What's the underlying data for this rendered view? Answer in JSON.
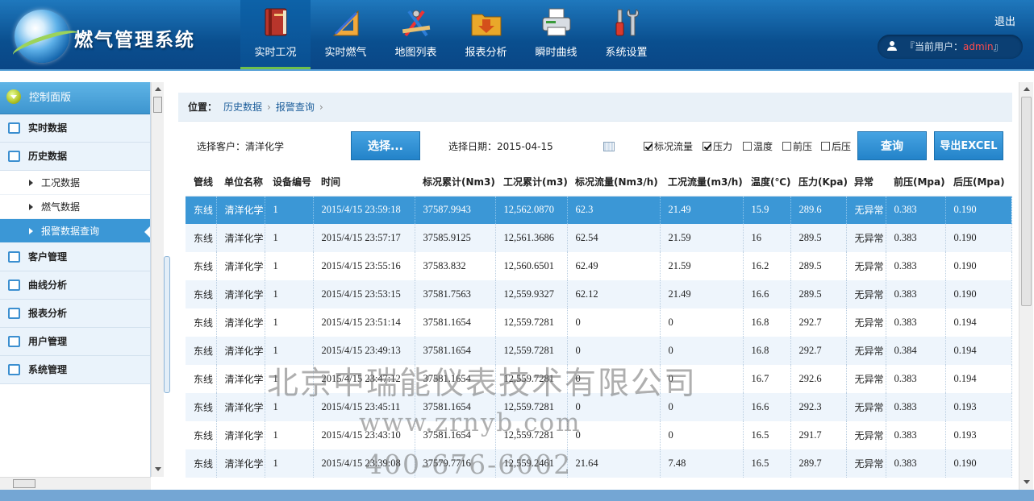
{
  "header": {
    "app_title": "燃气管理系统",
    "logout": "退出",
    "user_label": "『当前用户：",
    "user_name": "admin",
    "user_suffix": "』",
    "nav": [
      {
        "label": "实时工况",
        "icon": "book-icon",
        "active": true
      },
      {
        "label": "实时燃气",
        "icon": "ruler-icon"
      },
      {
        "label": "地图列表",
        "icon": "drafting-tools-icon"
      },
      {
        "label": "报表分析",
        "icon": "folder-download-icon"
      },
      {
        "label": "瞬时曲线",
        "icon": "printer-icon"
      },
      {
        "label": "系统设置",
        "icon": "tools-icon"
      }
    ]
  },
  "sidebar": {
    "head": "控制面版",
    "items": [
      {
        "label": "实时数据",
        "icon": "list-icon"
      },
      {
        "label": "历史数据",
        "icon": "chat-icon"
      }
    ],
    "subitems": [
      {
        "label": "工况数据"
      },
      {
        "label": "燃气数据"
      },
      {
        "label": "报警数据查询",
        "active": true
      }
    ],
    "items_after": [
      {
        "label": "客户管理",
        "icon": "edit-icon"
      },
      {
        "label": "曲线分析",
        "icon": "calendar-icon"
      },
      {
        "label": "报表分析",
        "icon": "calendar-icon"
      },
      {
        "label": "用户管理",
        "icon": "calendar-icon"
      },
      {
        "label": "系统管理",
        "icon": "calendar-icon"
      }
    ]
  },
  "breadcrumb": {
    "label": "位置：",
    "part1": "历史数据",
    "sep1": "›",
    "part2": "报警查询",
    "sep2": "›"
  },
  "filter": {
    "customer_label": "选择客户：清洋化学",
    "select_button": "选择...",
    "date_label": "选择日期：2015-04-15",
    "checks": [
      {
        "label": "标况流量",
        "checked": true
      },
      {
        "label": "压力",
        "checked": true
      },
      {
        "label": "温度",
        "checked": false
      },
      {
        "label": "前压",
        "checked": false
      },
      {
        "label": "后压",
        "checked": false
      }
    ],
    "query_button": "查询",
    "export_button": "导出EXCEL"
  },
  "table": {
    "columns": [
      "管线",
      "单位名称",
      "设备编号",
      "时间",
      "标况累计(Nm3)",
      "工况累计(m3)",
      "标况流量(Nm3/h)",
      "工况流量(m3/h)",
      "温度(℃)",
      "压力(Kpa)",
      "异常",
      "前压(Mpa)",
      "后压(Mpa)"
    ],
    "rows": [
      [
        "东线",
        "清洋化学",
        "1",
        "2015/4/15 23:59:18",
        "37587.9943",
        "12,562.0870",
        "62.3",
        "21.49",
        "15.9",
        "289.6",
        "无异常",
        "0.383",
        "0.190"
      ],
      [
        "东线",
        "清洋化学",
        "1",
        "2015/4/15 23:57:17",
        "37585.9125",
        "12,561.3686",
        "62.54",
        "21.59",
        "16",
        "289.5",
        "无异常",
        "0.383",
        "0.190"
      ],
      [
        "东线",
        "清洋化学",
        "1",
        "2015/4/15 23:55:16",
        "37583.832",
        "12,560.6501",
        "62.49",
        "21.59",
        "16.2",
        "289.5",
        "无异常",
        "0.383",
        "0.190"
      ],
      [
        "东线",
        "清洋化学",
        "1",
        "2015/4/15 23:53:15",
        "37581.7563",
        "12,559.9327",
        "62.12",
        "21.49",
        "16.6",
        "289.5",
        "无异常",
        "0.383",
        "0.190"
      ],
      [
        "东线",
        "清洋化学",
        "1",
        "2015/4/15 23:51:14",
        "37581.1654",
        "12,559.7281",
        "0",
        "0",
        "16.8",
        "292.7",
        "无异常",
        "0.383",
        "0.194"
      ],
      [
        "东线",
        "清洋化学",
        "1",
        "2015/4/15 23:49:13",
        "37581.1654",
        "12,559.7281",
        "0",
        "0",
        "16.8",
        "292.7",
        "无异常",
        "0.384",
        "0.194"
      ],
      [
        "东线",
        "清洋化学",
        "1",
        "2015/4/15 23:47:12",
        "37581.1654",
        "12,559.7281",
        "0",
        "0",
        "16.7",
        "292.6",
        "无异常",
        "0.383",
        "0.194"
      ],
      [
        "东线",
        "清洋化学",
        "1",
        "2015/4/15 23:45:11",
        "37581.1654",
        "12,559.7281",
        "0",
        "0",
        "16.6",
        "292.3",
        "无异常",
        "0.383",
        "0.193"
      ],
      [
        "东线",
        "清洋化学",
        "1",
        "2015/4/15 23:43:10",
        "37581.1654",
        "12,559.7281",
        "0",
        "0",
        "16.5",
        "291.7",
        "无异常",
        "0.383",
        "0.193"
      ],
      [
        "东线",
        "清洋化学",
        "1",
        "2015/4/15 23:39:08",
        "37579.7716",
        "12,559.2461",
        "21.64",
        "7.48",
        "16.5",
        "289.7",
        "无异常",
        "0.383",
        "0.190"
      ]
    ]
  },
  "watermark": {
    "company": "北京中瑞能仪表技术有限公司",
    "site": "www.zrnyb.com",
    "phone": "400-676-6002"
  }
}
